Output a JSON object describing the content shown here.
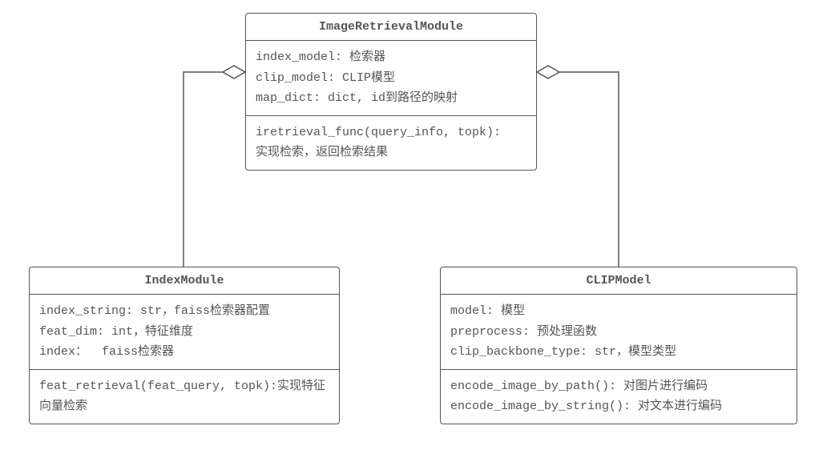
{
  "classes": {
    "imageRetrievalModule": {
      "title": "ImageRetrievalModule",
      "attrs": [
        "index_model: 检索器",
        "clip_model: CLIP模型",
        "map_dict: dict, id到路径的映射"
      ],
      "methods": [
        "iretrieval_func(query_info, topk):",
        "实现检索，返回检索结果"
      ]
    },
    "indexModule": {
      "title": "IndexModule",
      "attrs": [
        "index_string: str，faiss检索器配置",
        "feat_dim: int，特征维度",
        "index：  faiss检索器"
      ],
      "methods": [
        "feat_retrieval(feat_query, topk):实现特征向量检索"
      ]
    },
    "clipModel": {
      "title": "CLIPModel",
      "attrs": [
        "model: 模型",
        "preprocess: 预处理函数",
        "clip_backbone_type: str，模型类型"
      ],
      "methods": [
        "encode_image_by_path(): 对图片进行编码",
        "encode_image_by_string(): 对文本进行编码"
      ]
    }
  },
  "relations": [
    {
      "from": "ImageRetrievalModule",
      "to": "IndexModule",
      "type": "aggregation"
    },
    {
      "from": "ImageRetrievalModule",
      "to": "CLIPModel",
      "type": "aggregation"
    }
  ]
}
